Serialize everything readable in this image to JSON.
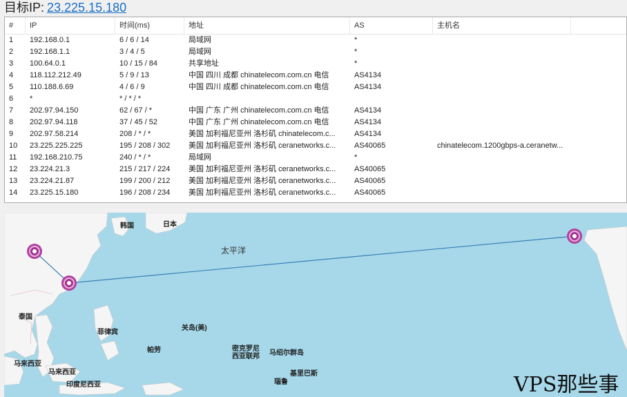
{
  "target": {
    "label": "目标IP:",
    "ip": "23.225.15.180"
  },
  "table": {
    "headers": [
      "#",
      "IP",
      "时间(ms)",
      "地址",
      "AS",
      "主机名"
    ],
    "rows": [
      [
        "1",
        "192.168.0.1",
        "6 / 6 / 14",
        "局域网",
        "*",
        ""
      ],
      [
        "2",
        "192.168.1.1",
        "3 / 4 / 5",
        "局域网",
        "*",
        ""
      ],
      [
        "3",
        "100.64.0.1",
        "10 / 15 / 84",
        "共享地址",
        "*",
        ""
      ],
      [
        "4",
        "118.112.212.49",
        "5 / 9 / 13",
        "中国 四川 成都 chinatelecom.com.cn 电信",
        "AS4134",
        ""
      ],
      [
        "5",
        "110.188.6.69",
        "4 / 6 / 9",
        "中国 四川 成都 chinatelecom.com.cn 电信",
        "AS4134",
        ""
      ],
      [
        "6",
        "*",
        "* / * / *",
        "",
        "",
        ""
      ],
      [
        "7",
        "202.97.94.150",
        "62 / 67 / *",
        "中国 广东 广州 chinatelecom.com.cn 电信",
        "AS4134",
        ""
      ],
      [
        "8",
        "202.97.94.118",
        "37 / 45 / 52",
        "中国 广东 广州 chinatelecom.com.cn 电信",
        "AS4134",
        ""
      ],
      [
        "9",
        "202.97.58.214",
        "208 / * / *",
        "美国 加利福尼亚州 洛杉矶 chinatelecom.c...",
        "AS4134",
        ""
      ],
      [
        "10",
        "23.225.225.225",
        "195 / 208 / 302",
        "美国 加利福尼亚州 洛杉矶 ceranetworks.c...",
        "AS40065",
        "chinatelecom.1200gbps-a.ceranetw..."
      ],
      [
        "11",
        "192.168.210.75",
        "240 / * / *",
        "局域网",
        "*",
        ""
      ],
      [
        "12",
        "23.224.21.3",
        "215 / 217 / 224",
        "美国 加利福尼亚州 洛杉矶 ceranetworks.c...",
        "AS40065",
        ""
      ],
      [
        "13",
        "23.224.21.87",
        "199 / 200 / 212",
        "美国 加利福尼亚州 洛杉矶 ceranetworks.c...",
        "AS40065",
        ""
      ],
      [
        "14",
        "23.225.15.180",
        "196 / 208 / 234",
        "美国 加利福尼亚州 洛杉矶 ceranetworks.c...",
        "AS40065",
        ""
      ]
    ]
  },
  "map": {
    "labels": {
      "korea": "韩国",
      "japan": "日本",
      "pacific": "太平洋",
      "thailand": "泰国",
      "philippines": "菲律宾",
      "guam": "关岛(美)",
      "palau": "帕劳",
      "micronesia": "密克罗尼西亚联邦",
      "marshall": "马绍尔群岛",
      "malaysia1": "马来西亚",
      "malaysia2": "马来西亚",
      "indonesia": "印度尼西亚",
      "nauru": "瑙鲁",
      "kiribati": "基里巴斯"
    },
    "colors": {
      "sea": "#a6d8ea",
      "land": "#f5f5f5",
      "route": "#3a7fb5",
      "pin": "#a43390"
    }
  },
  "watermark": "VPS那些事"
}
